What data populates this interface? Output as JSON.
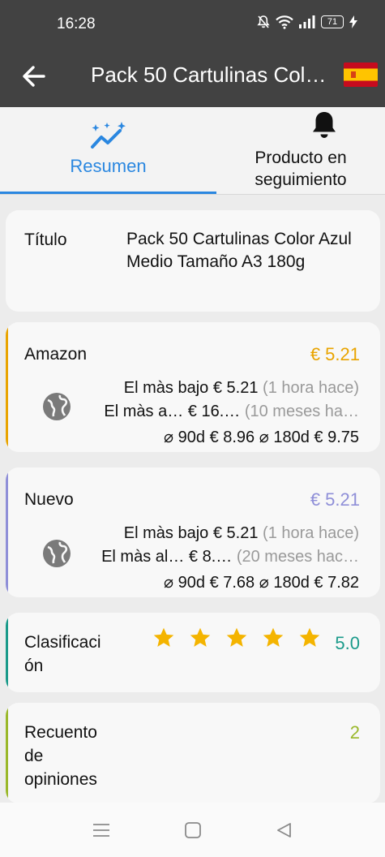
{
  "status": {
    "time": "16:28",
    "battery": "71"
  },
  "header": {
    "title": "Pack 50 Cartulinas Col…"
  },
  "tabs": {
    "summary": "Resumen",
    "tracking": "Producto en seguimiento"
  },
  "title_card": {
    "label": "Título",
    "value": "Pack 50 Cartulinas Color Azul Medio Tamaño A3 180g"
  },
  "amazon": {
    "label": "Amazon",
    "price": "€ 5.21",
    "color": "#e9a400",
    "low_label": "El màs bajo",
    "low_price": "€ 5.21",
    "low_time": "(1 hora hace)",
    "high_label": "El màs a…",
    "high_price": "€ 16.…",
    "high_time": "(10 meses ha…",
    "avg90_label": "⌀ 90d",
    "avg90": "€ 8.96",
    "avg180_label": "⌀ 180d",
    "avg180": "€ 9.75"
  },
  "new": {
    "label": "Nuevo",
    "price": "€ 5.21",
    "color": "#8f8fd8",
    "low_label": "El màs bajo",
    "low_price": "€ 5.21",
    "low_time": "(1 hora hace)",
    "high_label": "El màs al…",
    "high_price": "€ 8.…",
    "high_time": "(20 meses hac…",
    "avg90_label": "⌀ 90d",
    "avg90": "€ 7.68",
    "avg180_label": "⌀ 180d",
    "avg180": "€ 7.82"
  },
  "rating": {
    "label": "Clasificaci ón",
    "value": "5.0",
    "stars": 5,
    "color": "#1a9a8a",
    "star_color": "#f4b400"
  },
  "reviews": {
    "label": "Recuento de opiniones",
    "value": "2",
    "color": "#9ab82a"
  },
  "colors": {
    "accent_blue": "#2a87e0",
    "bar_dark": "#424242"
  }
}
